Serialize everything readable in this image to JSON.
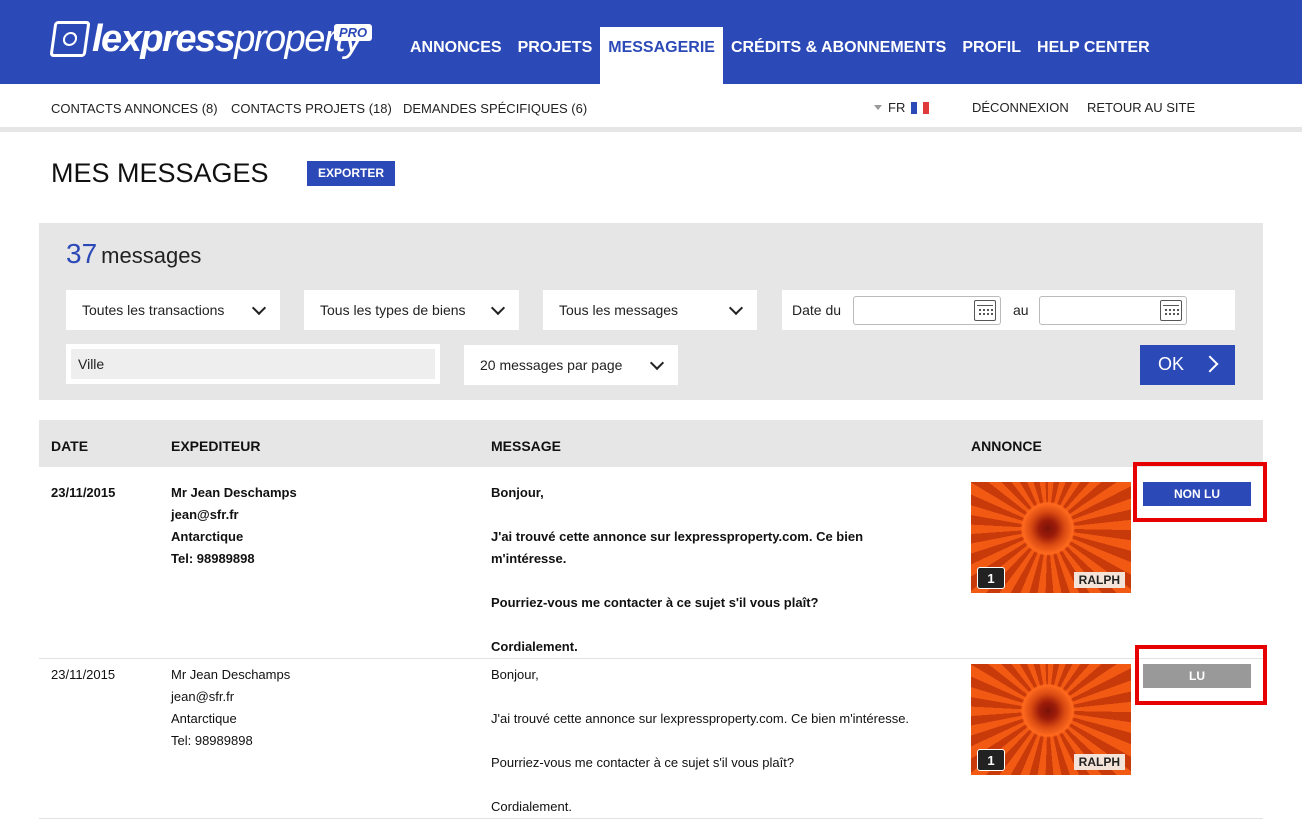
{
  "header": {
    "logo": {
      "word_bold": "lexpress",
      "word_light": "property",
      "badge": "PRO"
    },
    "nav": [
      {
        "label": "ANNONCES",
        "active": false
      },
      {
        "label": "PROJETS",
        "active": false
      },
      {
        "label": "MESSAGERIE",
        "active": true
      },
      {
        "label": "CRÉDITS & ABONNEMENTS",
        "active": false
      },
      {
        "label": "PROFIL",
        "active": false
      },
      {
        "label": "HELP CENTER",
        "active": false
      }
    ]
  },
  "subnav": {
    "links": [
      "CONTACTS ANNONCES (8)",
      "CONTACTS PROJETS (18)",
      "DEMANDES SPÉCIFIQUES (6)"
    ],
    "language": "FR",
    "logout": "DÉCONNEXION",
    "back": "RETOUR AU SITE"
  },
  "page": {
    "title": "MES MESSAGES",
    "export_label": "EXPORTER"
  },
  "filters": {
    "count": "37",
    "count_label": "messages",
    "transactions": "Toutes les transactions",
    "property_types": "Tous les types de biens",
    "messages": "Tous les messages",
    "date_from_label": "Date du",
    "date_to_label": "au",
    "date_from": "",
    "date_to": "",
    "city_placeholder": "Ville",
    "per_page": "20 messages par page",
    "ok_label": "OK"
  },
  "table": {
    "headers": [
      "DATE",
      "EXPEDITEUR",
      "MESSAGE",
      "ANNONCE"
    ],
    "rows": [
      {
        "date": "23/11/2015",
        "sender": {
          "name": "Mr Jean Deschamps",
          "email": "jean@sfr.fr",
          "location": "Antarctique",
          "tel": "Tel: 98989898"
        },
        "message": [
          "Bonjour,",
          "J'ai trouvé cette annonce sur lexpressproperty.com. Ce bien m'intéresse.",
          "Pourriez-vous me contacter à ce sujet s'il vous plaît?",
          "Cordialement."
        ],
        "listing": {
          "photo_count": "1",
          "agent": "RALPH"
        },
        "status": "NON LU",
        "unread": true
      },
      {
        "date": "23/11/2015",
        "sender": {
          "name": "Mr Jean Deschamps",
          "email": "jean@sfr.fr",
          "location": "Antarctique",
          "tel": "Tel: 98989898"
        },
        "message": [
          "Bonjour,",
          "J'ai trouvé cette annonce sur lexpressproperty.com. Ce bien m'intéresse.",
          "Pourriez-vous me contacter à ce sujet s'il vous plaît?",
          "Cordialement."
        ],
        "listing": {
          "photo_count": "1",
          "agent": "RALPH"
        },
        "status": "LU",
        "unread": false
      }
    ]
  },
  "colors": {
    "brand": "#2c49b8",
    "panel": "#e6e6e6",
    "read": "#999999",
    "highlight": "#e60000",
    "listing_photo": "#e0521a"
  }
}
